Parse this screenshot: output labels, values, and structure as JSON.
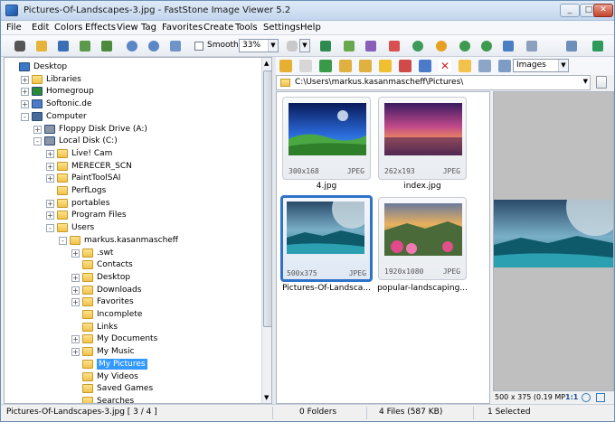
{
  "window": {
    "title": "Pictures-Of-Landscapes-3.jpg  -  FastStone Image Viewer 5.2"
  },
  "menu": [
    "File",
    "Edit",
    "Colors",
    "Effects",
    "View",
    "Tag",
    "Favorites",
    "Create",
    "Tools",
    "Settings",
    "Help"
  ],
  "toolbar": {
    "smooth_label": "Smooth",
    "zoom_value": "33%"
  },
  "tree": [
    {
      "label": "Desktop",
      "depth": 0,
      "expander": "",
      "icon": "desktop"
    },
    {
      "label": "Libraries",
      "depth": 1,
      "expander": "+",
      "icon": "folder"
    },
    {
      "label": "Homegroup",
      "depth": 1,
      "expander": "+",
      "icon": "homegroup"
    },
    {
      "label": "Softonic.de",
      "depth": 1,
      "expander": "+",
      "icon": "user"
    },
    {
      "label": "Computer",
      "depth": 1,
      "expander": "-",
      "icon": "computer"
    },
    {
      "label": "Floppy Disk Drive (A:)",
      "depth": 2,
      "expander": "+",
      "icon": "drive"
    },
    {
      "label": "Local Disk (C:)",
      "depth": 2,
      "expander": "-",
      "icon": "drive"
    },
    {
      "label": "Live! Cam",
      "depth": 3,
      "expander": "+",
      "icon": "folder"
    },
    {
      "label": "MERECER_SCN",
      "depth": 3,
      "expander": "+",
      "icon": "folder"
    },
    {
      "label": "PaintToolSAI",
      "depth": 3,
      "expander": "+",
      "icon": "folder"
    },
    {
      "label": "PerfLogs",
      "depth": 3,
      "expander": "",
      "icon": "folder"
    },
    {
      "label": "portables",
      "depth": 3,
      "expander": "+",
      "icon": "folder"
    },
    {
      "label": "Program Files",
      "depth": 3,
      "expander": "+",
      "icon": "folder"
    },
    {
      "label": "Users",
      "depth": 3,
      "expander": "-",
      "icon": "folder"
    },
    {
      "label": "markus.kasanmascheff",
      "depth": 4,
      "expander": "-",
      "icon": "folder"
    },
    {
      "label": ".swt",
      "depth": 5,
      "expander": "+",
      "icon": "folder"
    },
    {
      "label": "Contacts",
      "depth": 5,
      "expander": "",
      "icon": "folder"
    },
    {
      "label": "Desktop",
      "depth": 5,
      "expander": "+",
      "icon": "folder"
    },
    {
      "label": "Downloads",
      "depth": 5,
      "expander": "+",
      "icon": "folder"
    },
    {
      "label": "Favorites",
      "depth": 5,
      "expander": "+",
      "icon": "folder"
    },
    {
      "label": "Incomplete",
      "depth": 5,
      "expander": "",
      "icon": "folder"
    },
    {
      "label": "Links",
      "depth": 5,
      "expander": "",
      "icon": "folder"
    },
    {
      "label": "My Documents",
      "depth": 5,
      "expander": "+",
      "icon": "folder"
    },
    {
      "label": "My Music",
      "depth": 5,
      "expander": "+",
      "icon": "folder"
    },
    {
      "label": "My Pictures",
      "depth": 5,
      "expander": "",
      "icon": "folder",
      "selected": true
    },
    {
      "label": "My Videos",
      "depth": 5,
      "expander": "",
      "icon": "folder"
    },
    {
      "label": "Saved Games",
      "depth": 5,
      "expander": "",
      "icon": "folder"
    },
    {
      "label": "Searches",
      "depth": 5,
      "expander": "",
      "icon": "folder"
    }
  ],
  "nav": {
    "filter": "Images"
  },
  "path": "C:\\Users\\markus.kasanmascheff\\Pictures\\",
  "thumbnails": [
    {
      "dims": "300x168",
      "format": "JPEG",
      "caption": "4.jpg"
    },
    {
      "dims": "262x193",
      "format": "JPEG",
      "caption": "index.jpg"
    },
    {
      "dims": "500x375",
      "format": "JPEG",
      "caption": "Pictures-Of-Landsca...",
      "selected": true
    },
    {
      "dims": "1920x1080",
      "format": "JPEG",
      "caption": "popular-landscaping..."
    }
  ],
  "preview": {
    "info": "500 x 375 (0.19 MP",
    "ratio": "1:1"
  },
  "status": {
    "file": "Pictures-Of-Landscapes-3.jpg [ 3 / 4 ]",
    "folders": "0 Folders",
    "files": "4 Files (587 KB)",
    "selected": "1 Selected"
  },
  "colors": {
    "selection_border": "#2f73c9",
    "tree_highlight": "#3399ff",
    "window_border": "#6b8fb5"
  }
}
